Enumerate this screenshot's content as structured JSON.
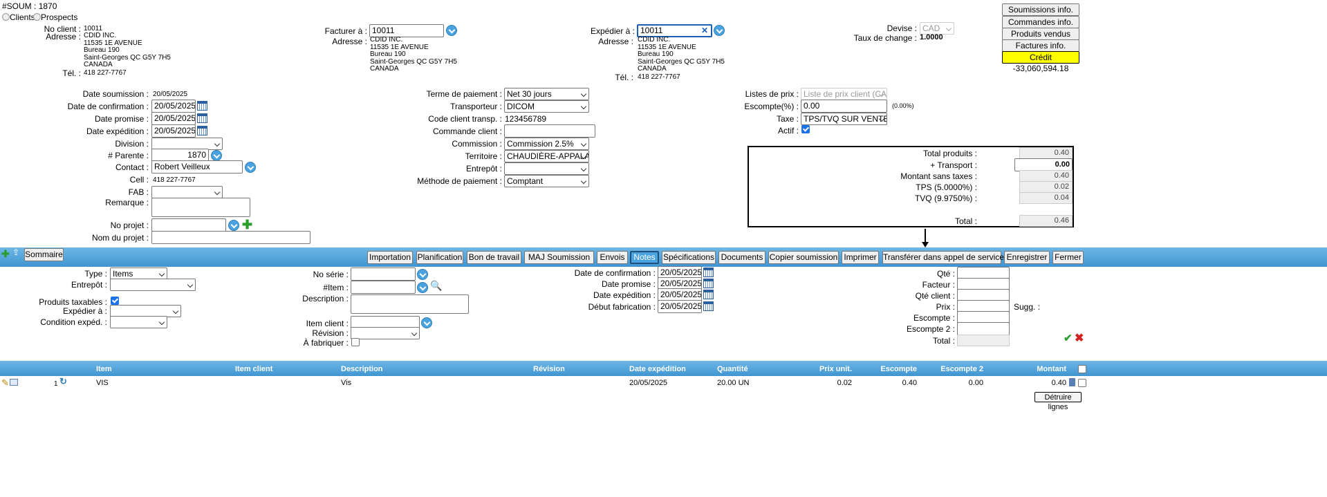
{
  "header": {
    "soum_label": "#SOUM :",
    "soum_number": "1870"
  },
  "client_type": {
    "clients": "Clients",
    "prospects": "Prospects"
  },
  "client": {
    "no_label": "No client :",
    "no": "10011",
    "address_label": "Adresse :",
    "address": [
      "CDID INC.",
      "11535 1E AVENUE",
      "Bureau 190",
      "Saint-Georges QC G5Y 7H5",
      "CANADA"
    ],
    "tel_label": "Tél. :",
    "tel": "418 227-7767"
  },
  "billing": {
    "label": "Facturer à :",
    "value": "10011",
    "address_label": "Adresse :",
    "address": [
      "CDID INC.",
      "11535 1E AVENUE",
      "Bureau 190",
      "Saint-Georges QC G5Y 7H5",
      "CANADA"
    ]
  },
  "shipping": {
    "label": "Expédier à :",
    "value": "10011",
    "address_label": "Adresse :",
    "address": [
      "CDID INC.",
      "11535 1E AVENUE",
      "Bureau 190",
      "Saint-Georges QC G5Y 7H5",
      "CANADA"
    ],
    "tel_label": "Tél. :",
    "tel": "418 227-7767"
  },
  "currency": {
    "devise_label": "Devise :",
    "devise": "CAD",
    "rate_label": "Taux de change :",
    "rate": "1.0000"
  },
  "right_buttons": [
    "Soumissions info.",
    "Commandes info.",
    "Produits vendus",
    "Factures info.",
    "Crédit -33,060,594.18"
  ],
  "form_left": {
    "date_soumission_label": "Date soumission :",
    "date_soumission": "20/05/2025",
    "date_confirmation_label": "Date de confirmation :",
    "date_confirmation": "20/05/2025",
    "date_promise_label": "Date promise :",
    "date_promise": "20/05/2025",
    "date_expedition_label": "Date expédition :",
    "date_expedition": "20/05/2025",
    "division_label": "Division :",
    "division": "",
    "parente_label": "# Parente :",
    "parente": "1870",
    "contact_label": "Contact :",
    "contact": "Robert Veilleux",
    "cell_label": "Cell :",
    "cell": "418 227-7767",
    "fab_label": "FAB :",
    "fab": "",
    "remarque_label": "Remarque :",
    "no_projet_label": "No projet :",
    "nom_projet_label": "Nom du projet :"
  },
  "form_mid": {
    "terme_label": "Terme de paiement :",
    "terme": "Net 30 jours",
    "transporteur_label": "Transporteur :",
    "transporteur": "DICOM",
    "code_transp_label": "Code client transp. :",
    "code_transp": "123456789",
    "commande_label": "Commande client :",
    "commission_label": "Commission :",
    "commission": "Commission 2.5%",
    "territoire_label": "Territoire :",
    "territoire": "CHAUDIÈRE-APPALAC",
    "entrepot_label": "Entrepôt :",
    "entrepot": "",
    "methode_label": "Méthode de paiement :",
    "methode": "Comptant"
  },
  "form_right": {
    "listes_label": "Listes de prix :",
    "listes": "Liste de prix client (CAD",
    "escompte_label": "Escompte(%) :",
    "escompte": "0.00",
    "escompte_pct": "(0.00%)",
    "taxe_label": "Taxe :",
    "taxe": "TPS/TVQ SUR VENTES",
    "actif_label": "Actif :"
  },
  "totals": {
    "total_produits_label": "Total produits :",
    "total_produits": "0.40",
    "transport_label": "+ Transport :",
    "transport": "0.00",
    "montant_label": "Montant sans taxes :",
    "montant": "0.40",
    "tps_label": "TPS (5.0000%) :",
    "tps": "0.02",
    "tvq_label": "TVQ (9.9750%) :",
    "tvq": "0.04",
    "total_label": "Total :",
    "total": "0.46"
  },
  "toolbar": {
    "sommaire": "Sommaire",
    "tabs": [
      "Importation",
      "Planification",
      "Bon de travail",
      "MAJ Soumission",
      "Envois",
      "Notes",
      "Spécifications",
      "Documents",
      "Copier soumission",
      "Imprimer",
      "Transférer dans appel de service",
      "Enregistrer",
      "Fermer"
    ],
    "active": "Notes"
  },
  "line_form": {
    "type_label": "Type :",
    "type": "Items",
    "entrepot_label": "Entrepôt :",
    "produits_taxables_label": "Produits taxables :",
    "expedier_label": "Expédier à :",
    "condition_label": "Condition expéd. :",
    "no_serie_label": "No série :",
    "item_label": "#Item :",
    "description_label": "Description :",
    "item_client_label": "Item client :",
    "revision_label": "Révision :",
    "a_fabriquer_label": "À fabriquer :",
    "date_confirmation_label": "Date de confirmation :",
    "date_confirmation": "20/05/2025",
    "date_promise_label": "Date promise :",
    "date_promise": "20/05/2025",
    "date_expedition_label": "Date expédition :",
    "date_expedition": "20/05/2025",
    "debut_fab_label": "Début fabrication :",
    "debut_fab": "20/05/2025",
    "qte_label": "Qté :",
    "facteur_label": "Facteur :",
    "qte_client_label": "Qté client :",
    "prix_label": "Prix :",
    "sugg_label": "Sugg. :",
    "escompte_label": "Escompte :",
    "escompte2_label": "Escompte 2 :",
    "total_label": "Total :"
  },
  "table": {
    "columns": [
      "Item",
      "Item client",
      "Description",
      "Révision",
      "Date expédition",
      "Quantité",
      "Prix unit.",
      "Escompte",
      "Escompte 2",
      "Montant"
    ],
    "rows": [
      {
        "num": "1",
        "item": "VIS",
        "item_client": "",
        "description": "Vis",
        "revision": "",
        "date_expedition": "20/05/2025",
        "quantite": "20.00 UN",
        "prix_unit": "0.02",
        "escompte": "0.40",
        "escompte2": "0.00",
        "montant": "0.40"
      }
    ]
  },
  "detruire_lignes": "Détruire lignes"
}
